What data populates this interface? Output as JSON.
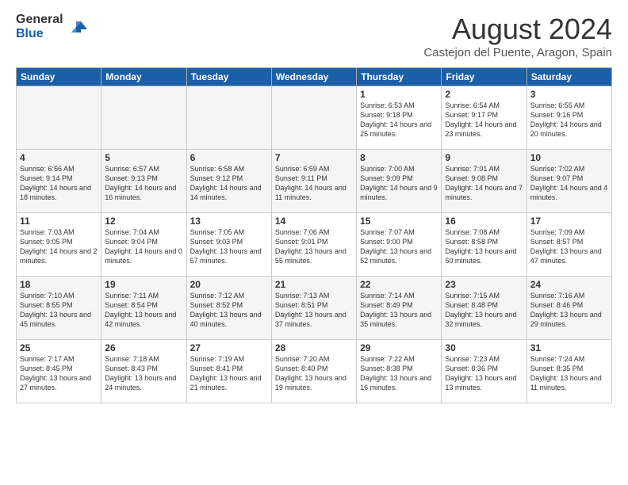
{
  "header": {
    "logo": {
      "general": "General",
      "blue": "Blue"
    },
    "title": "August 2024",
    "location": "Castejon del Puente, Aragon, Spain"
  },
  "days_of_week": [
    "Sunday",
    "Monday",
    "Tuesday",
    "Wednesday",
    "Thursday",
    "Friday",
    "Saturday"
  ],
  "weeks": [
    {
      "cells": [
        {
          "empty": true
        },
        {
          "empty": true
        },
        {
          "empty": true
        },
        {
          "empty": true
        },
        {
          "day": 1,
          "sunrise": "6:53 AM",
          "sunset": "9:18 PM",
          "daylight": "14 hours and 25 minutes."
        },
        {
          "day": 2,
          "sunrise": "6:54 AM",
          "sunset": "9:17 PM",
          "daylight": "14 hours and 23 minutes."
        },
        {
          "day": 3,
          "sunrise": "6:55 AM",
          "sunset": "9:16 PM",
          "daylight": "14 hours and 20 minutes."
        }
      ]
    },
    {
      "cells": [
        {
          "day": 4,
          "sunrise": "6:56 AM",
          "sunset": "9:14 PM",
          "daylight": "14 hours and 18 minutes."
        },
        {
          "day": 5,
          "sunrise": "6:57 AM",
          "sunset": "9:13 PM",
          "daylight": "14 hours and 16 minutes."
        },
        {
          "day": 6,
          "sunrise": "6:58 AM",
          "sunset": "9:12 PM",
          "daylight": "14 hours and 14 minutes."
        },
        {
          "day": 7,
          "sunrise": "6:59 AM",
          "sunset": "9:11 PM",
          "daylight": "14 hours and 11 minutes."
        },
        {
          "day": 8,
          "sunrise": "7:00 AM",
          "sunset": "9:09 PM",
          "daylight": "14 hours and 9 minutes."
        },
        {
          "day": 9,
          "sunrise": "7:01 AM",
          "sunset": "9:08 PM",
          "daylight": "14 hours and 7 minutes."
        },
        {
          "day": 10,
          "sunrise": "7:02 AM",
          "sunset": "9:07 PM",
          "daylight": "14 hours and 4 minutes."
        }
      ]
    },
    {
      "cells": [
        {
          "day": 11,
          "sunrise": "7:03 AM",
          "sunset": "9:05 PM",
          "daylight": "14 hours and 2 minutes."
        },
        {
          "day": 12,
          "sunrise": "7:04 AM",
          "sunset": "9:04 PM",
          "daylight": "14 hours and 0 minutes."
        },
        {
          "day": 13,
          "sunrise": "7:05 AM",
          "sunset": "9:03 PM",
          "daylight": "13 hours and 57 minutes."
        },
        {
          "day": 14,
          "sunrise": "7:06 AM",
          "sunset": "9:01 PM",
          "daylight": "13 hours and 55 minutes."
        },
        {
          "day": 15,
          "sunrise": "7:07 AM",
          "sunset": "9:00 PM",
          "daylight": "13 hours and 52 minutes."
        },
        {
          "day": 16,
          "sunrise": "7:08 AM",
          "sunset": "8:58 PM",
          "daylight": "13 hours and 50 minutes."
        },
        {
          "day": 17,
          "sunrise": "7:09 AM",
          "sunset": "8:57 PM",
          "daylight": "13 hours and 47 minutes."
        }
      ]
    },
    {
      "cells": [
        {
          "day": 18,
          "sunrise": "7:10 AM",
          "sunset": "8:55 PM",
          "daylight": "13 hours and 45 minutes."
        },
        {
          "day": 19,
          "sunrise": "7:11 AM",
          "sunset": "8:54 PM",
          "daylight": "13 hours and 42 minutes."
        },
        {
          "day": 20,
          "sunrise": "7:12 AM",
          "sunset": "8:52 PM",
          "daylight": "13 hours and 40 minutes."
        },
        {
          "day": 21,
          "sunrise": "7:13 AM",
          "sunset": "8:51 PM",
          "daylight": "13 hours and 37 minutes."
        },
        {
          "day": 22,
          "sunrise": "7:14 AM",
          "sunset": "8:49 PM",
          "daylight": "13 hours and 35 minutes."
        },
        {
          "day": 23,
          "sunrise": "7:15 AM",
          "sunset": "8:48 PM",
          "daylight": "13 hours and 32 minutes."
        },
        {
          "day": 24,
          "sunrise": "7:16 AM",
          "sunset": "8:46 PM",
          "daylight": "13 hours and 29 minutes."
        }
      ]
    },
    {
      "cells": [
        {
          "day": 25,
          "sunrise": "7:17 AM",
          "sunset": "8:45 PM",
          "daylight": "13 hours and 27 minutes."
        },
        {
          "day": 26,
          "sunrise": "7:18 AM",
          "sunset": "8:43 PM",
          "daylight": "13 hours and 24 minutes."
        },
        {
          "day": 27,
          "sunrise": "7:19 AM",
          "sunset": "8:41 PM",
          "daylight": "13 hours and 21 minutes."
        },
        {
          "day": 28,
          "sunrise": "7:20 AM",
          "sunset": "8:40 PM",
          "daylight": "13 hours and 19 minutes."
        },
        {
          "day": 29,
          "sunrise": "7:22 AM",
          "sunset": "8:38 PM",
          "daylight": "13 hours and 16 minutes."
        },
        {
          "day": 30,
          "sunrise": "7:23 AM",
          "sunset": "8:36 PM",
          "daylight": "13 hours and 13 minutes."
        },
        {
          "day": 31,
          "sunrise": "7:24 AM",
          "sunset": "8:35 PM",
          "daylight": "13 hours and 11 minutes."
        }
      ]
    }
  ]
}
